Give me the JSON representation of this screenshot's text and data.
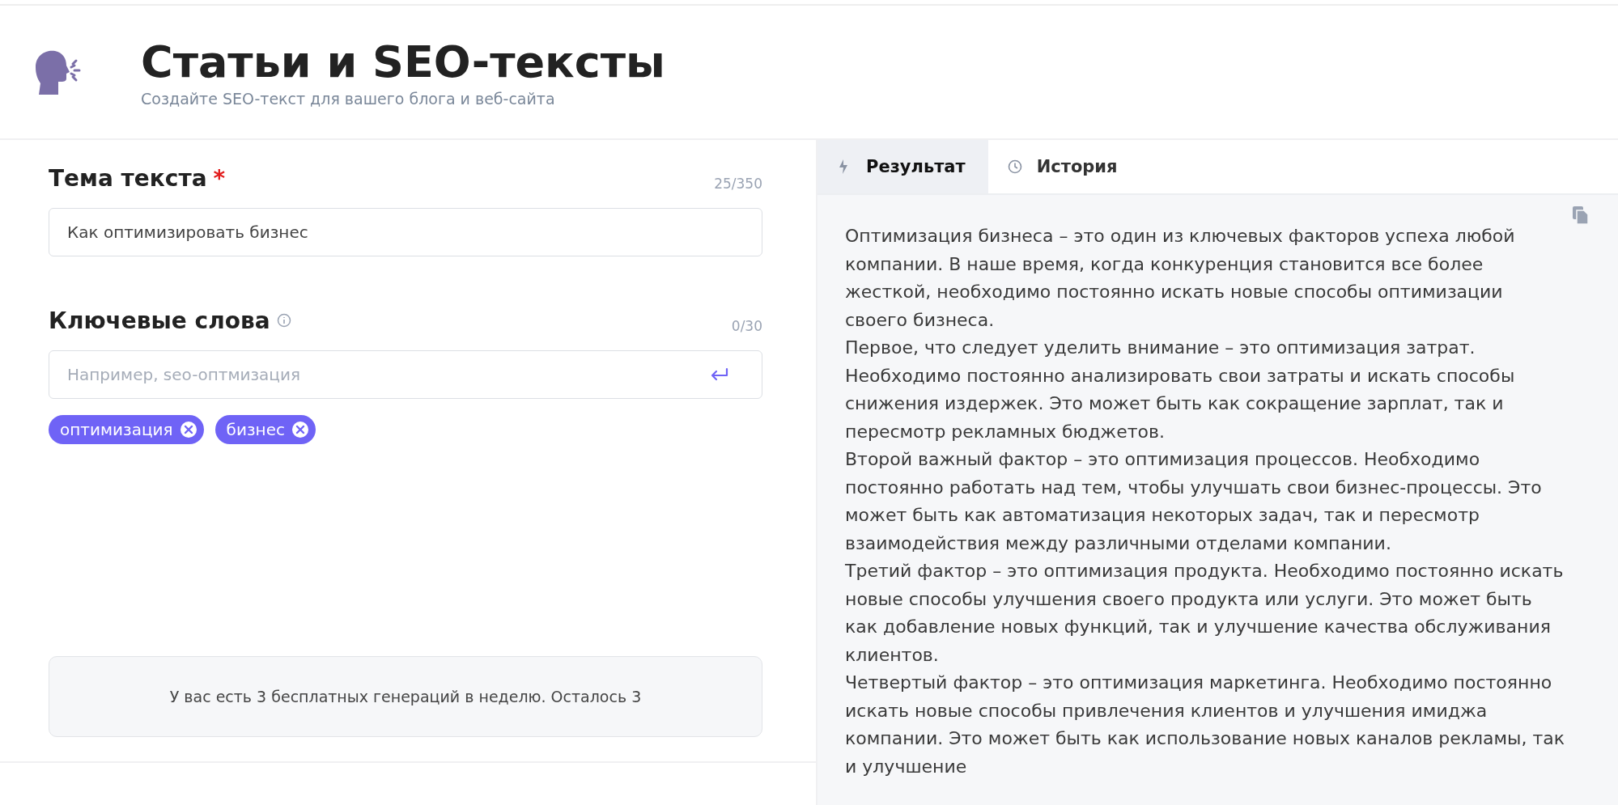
{
  "header": {
    "title": "Статьи и SEO-тексты",
    "subtitle": "Создайте SEO-текст для вашего блога и веб-сайта"
  },
  "form": {
    "topic": {
      "label": "Тема текста",
      "required_mark": "*",
      "counter": "25/350",
      "value": "Как оптимизировать бизнес"
    },
    "keywords": {
      "label": "Ключевые слова",
      "counter": "0/30",
      "placeholder": "Например, seo-оптмизация",
      "tags": [
        "оптимизация",
        "бизнес"
      ]
    },
    "notice": "У вас есть 3 бесплатных генераций в неделю. Осталось 3"
  },
  "tabs": [
    {
      "label": "Результат",
      "kind": "bolt",
      "selected": true
    },
    {
      "label": "История",
      "kind": "clock",
      "selected": false
    }
  ],
  "result": {
    "paragraphs": [
      "Оптимизация бизнеса – это один из ключевых факторов успеха любой компании. В наше время, когда конкуренция становится все более жесткой, необходимо постоянно искать новые способы оптимизации своего бизнеса.",
      "Первое, что следует уделить внимание – это оптимизация затрат. Необходимо постоянно анализировать свои затраты и искать способы снижения издержек. Это может быть как сокращение зарплат, так и пересмотр рекламных бюджетов.",
      "Второй важный фактор – это оптимизация процессов. Необходимо постоянно работать над тем, чтобы улучшать свои бизнес-процессы. Это может быть как автоматизация некоторых задач, так и пересмотр взаимодействия между различными отделами компании.",
      "Третий фактор – это оптимизация продукта. Необходимо постоянно искать новые способы улучшения своего продукта или услуги. Это может быть как добавление новых функций, так и улучшение качества обслуживания клиентов.",
      "Четвертый фактор – это оптимизация маркетинга. Необходимо постоянно искать новые способы привлечения клиентов и улучшения имиджа компании. Это может быть как использование новых каналов рекламы, так и улучшение"
    ]
  }
}
